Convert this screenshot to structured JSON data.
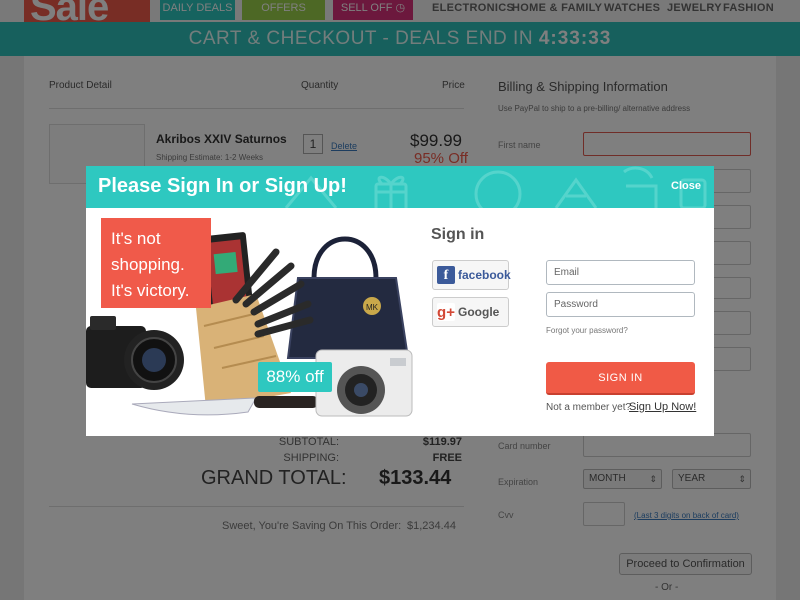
{
  "logo_text": "Sale",
  "nav": {
    "tabs": [
      {
        "label": "DAILY DEALS"
      },
      {
        "label": "OFFERS"
      },
      {
        "label": "SELL OFF"
      }
    ],
    "categories": [
      "ELECTRONICS",
      "HOME & FAMILY",
      "WATCHES",
      "JEWELRY",
      "FASHION"
    ]
  },
  "banner": {
    "text": "CART & CHECKOUT - DEALS END IN",
    "countdown": "4:33:33"
  },
  "cart": {
    "headers": {
      "product": "Product Detail",
      "quantity": "Quantity",
      "price": "Price"
    },
    "item": {
      "name": "Akribos XXIV Saturnos",
      "shipping": "Shipping Estimate: 1-2 Weeks",
      "qty": "1",
      "delete": "Delete",
      "price": "$99.99",
      "discount": "95% Off"
    },
    "summary": {
      "subtotal_label": "SUBTOTAL:",
      "subtotal": "$119.97",
      "shipping_label": "SHIPPING:",
      "shipping": "FREE",
      "grand_label": "GRAND TOTAL:",
      "grand": "$133.44",
      "saving_label": "Sweet, You're Saving On This Order:",
      "saving": "$1,234.44"
    }
  },
  "billing": {
    "title": "Billing & Shipping Information",
    "note": "Use PayPal to ship to a pre-billing/ alternative address",
    "first_name": "First name",
    "card_number": "Card number",
    "expiration": "Expiration",
    "month": "MONTH",
    "year": "YEAR",
    "cvv": "Cvv",
    "cvv_hint": "(Last 3 digits on back of card)",
    "proceed": "Proceed to Confirmation",
    "or": "- Or -"
  },
  "modal": {
    "title": "Please Sign In or Sign Up!",
    "close": "Close",
    "quote": [
      "It's not",
      "shopping.",
      "It's victory."
    ],
    "badge": "88% off",
    "signin_title": "Sign in",
    "facebook": "facebook",
    "google": "Google",
    "email_placeholder": "Email",
    "password_placeholder": "Password",
    "forgot": "Forgot your password?",
    "signin_button": "SIGN IN",
    "not_member": "Not a member yet?",
    "signup": "Sign Up Now!"
  }
}
